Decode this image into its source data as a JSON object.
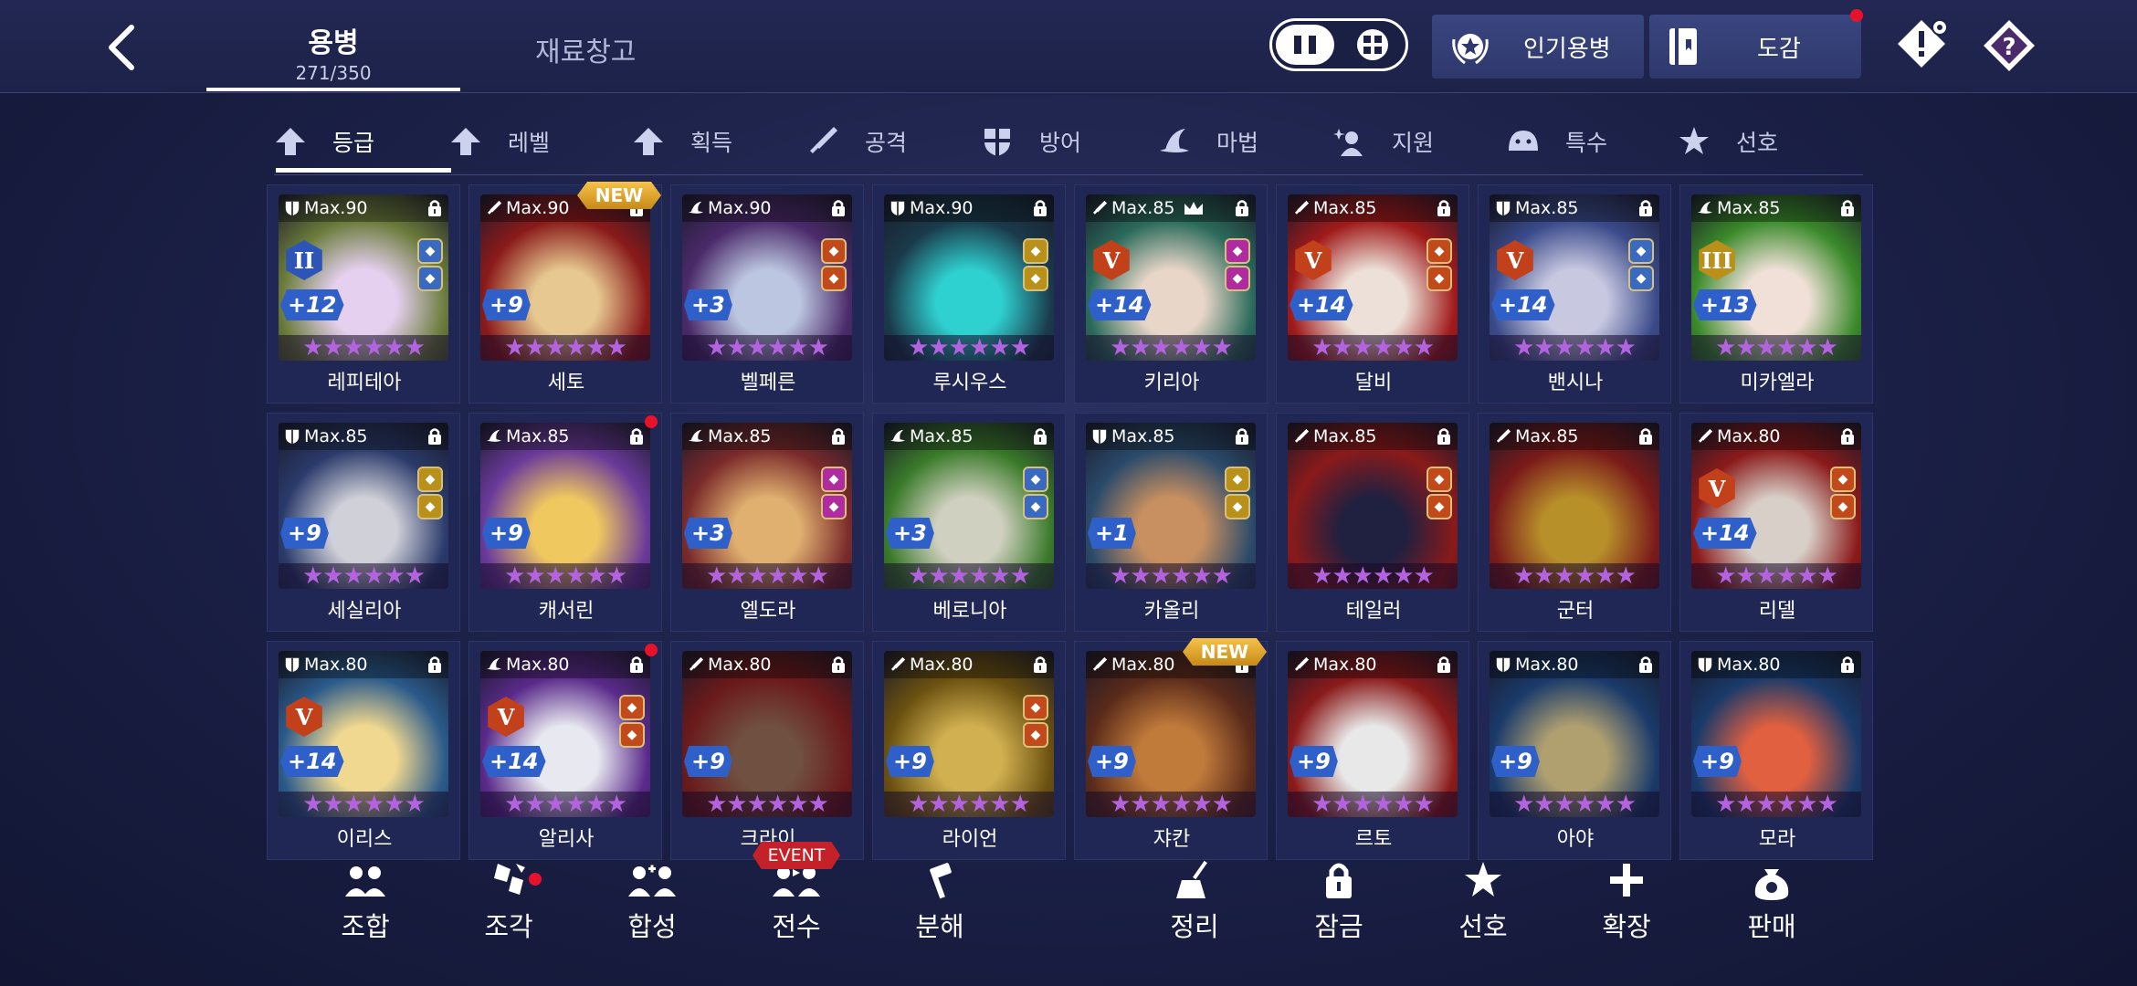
{
  "header": {
    "tab_main": {
      "label": "용병",
      "count": "271/350"
    },
    "tab_materials": "재료창고",
    "popular_label": "인기용병",
    "codex_label": "도감"
  },
  "filters": [
    {
      "label": "등급",
      "icon": "arrow-up-icon"
    },
    {
      "label": "레벨",
      "icon": "arrow-up-icon"
    },
    {
      "label": "획득",
      "icon": "arrow-up-icon"
    },
    {
      "label": "공격",
      "icon": "sword-icon"
    },
    {
      "label": "방어",
      "icon": "shield-icon"
    },
    {
      "label": "마법",
      "icon": "wizard-hat-icon"
    },
    {
      "label": "지원",
      "icon": "support-icon"
    },
    {
      "label": "특수",
      "icon": "blob-icon"
    },
    {
      "label": "선호",
      "icon": "star-icon"
    }
  ],
  "cards": [
    {
      "name": "레피테아",
      "max": "Max.90",
      "type": "shield",
      "plus": "+12",
      "rank": "II",
      "rankColor": "#2d55b8",
      "bg": [
        "#6a7b3a",
        "#e6d0f0"
      ],
      "gems": 2,
      "gemColor": "#3a6ac0",
      "new": false,
      "dot": false
    },
    {
      "name": "세토",
      "max": "Max.90",
      "type": "sword",
      "plus": "+9",
      "rank": "",
      "bg": [
        "#8a1a1a",
        "#e6c890"
      ],
      "gems": 0,
      "new": true,
      "newLabel": "NEW",
      "dot": false
    },
    {
      "name": "벨페른",
      "max": "Max.90",
      "type": "hat",
      "plus": "+3",
      "rank": "",
      "bg": [
        "#4a2a6a",
        "#bcc6e0"
      ],
      "gems": 2,
      "gemColor": "#c24a1a",
      "new": false,
      "dot": false
    },
    {
      "name": "루시우스",
      "max": "Max.90",
      "type": "shield",
      "plus": "",
      "rank": "",
      "bg": [
        "#1a3a4a",
        "#2fd0d0"
      ],
      "gems": 2,
      "gemColor": "#b8901a",
      "new": false,
      "dot": false
    },
    {
      "name": "키리아",
      "max": "Max.85",
      "type": "sword",
      "plus": "+14",
      "rank": "V",
      "rankColor": "#c2401a",
      "bg": [
        "#2a6a5a",
        "#e8d6c8"
      ],
      "gems": 2,
      "gemColor": "#b02aa0",
      "new": false,
      "dot": false,
      "crown": true
    },
    {
      "name": "달비",
      "max": "Max.85",
      "type": "sword",
      "plus": "+14",
      "rank": "V",
      "rankColor": "#c2401a",
      "bg": [
        "#a01a1a",
        "#ece0d8"
      ],
      "gems": 2,
      "gemColor": "#c24a1a",
      "new": false,
      "dot": false
    },
    {
      "name": "밴시나",
      "max": "Max.85",
      "type": "shield",
      "plus": "+14",
      "rank": "V",
      "rankColor": "#c2401a",
      "bg": [
        "#3a4a8a",
        "#c8c8e0"
      ],
      "gems": 2,
      "gemColor": "#3a6ac0",
      "new": false,
      "dot": false
    },
    {
      "name": "미카엘라",
      "max": "Max.85",
      "type": "hat",
      "plus": "+13",
      "rank": "III",
      "rankColor": "#b8901a",
      "bg": [
        "#3a8a2a",
        "#f0e0d8"
      ],
      "gems": 0,
      "new": false,
      "dot": false
    },
    {
      "name": "세실리아",
      "max": "Max.85",
      "type": "shield",
      "plus": "+9",
      "rank": "",
      "bg": [
        "#2a3a6a",
        "#d0d0d8"
      ],
      "gems": 2,
      "gemColor": "#b8901a",
      "new": false,
      "dot": false
    },
    {
      "name": "캐서린",
      "max": "Max.85",
      "type": "hat",
      "plus": "+9",
      "rank": "",
      "bg": [
        "#6a3a9a",
        "#f0c860"
      ],
      "gems": 0,
      "new": false,
      "dot": true
    },
    {
      "name": "엘도라",
      "max": "Max.85",
      "type": "hat",
      "plus": "+3",
      "rank": "",
      "bg": [
        "#7a2a2a",
        "#e0b070"
      ],
      "gems": 2,
      "gemColor": "#b02aa0",
      "new": false,
      "dot": false
    },
    {
      "name": "베로니아",
      "max": "Max.85",
      "type": "hat",
      "plus": "+3",
      "rank": "",
      "bg": [
        "#3a7a2a",
        "#d0d0c0"
      ],
      "gems": 2,
      "gemColor": "#3a6ac0",
      "new": false,
      "dot": false
    },
    {
      "name": "카올리",
      "max": "Max.85",
      "type": "shield",
      "plus": "+1",
      "rank": "",
      "bg": [
        "#2a4a6a",
        "#c89060"
      ],
      "gems": 2,
      "gemColor": "#b8901a",
      "new": false,
      "dot": false
    },
    {
      "name": "테일러",
      "max": "Max.85",
      "type": "sword",
      "plus": "",
      "rank": "",
      "bg": [
        "#8a1a1a",
        "#202040"
      ],
      "gems": 2,
      "gemColor": "#c24a1a",
      "new": false,
      "dot": false
    },
    {
      "name": "군터",
      "max": "Max.85",
      "type": "sword",
      "plus": "",
      "rank": "",
      "bg": [
        "#7a1a1a",
        "#b8902a"
      ],
      "gems": 0,
      "new": false,
      "dot": false
    },
    {
      "name": "리델",
      "max": "Max.80",
      "type": "sword",
      "plus": "+14",
      "rank": "V",
      "rankColor": "#c2401a",
      "bg": [
        "#8a1a1a",
        "#d8d0c8"
      ],
      "gems": 2,
      "gemColor": "#c24a1a",
      "new": false,
      "dot": false
    },
    {
      "name": "이리스",
      "max": "Max.80",
      "type": "shield",
      "plus": "+14",
      "rank": "V",
      "rankColor": "#c2401a",
      "bg": [
        "#2a5a8a",
        "#f0d890"
      ],
      "gems": 0,
      "new": false,
      "dot": false
    },
    {
      "name": "알리사",
      "max": "Max.80",
      "type": "hat",
      "plus": "+14",
      "rank": "V",
      "rankColor": "#c2401a",
      "bg": [
        "#5a2a8a",
        "#e8e8f0"
      ],
      "gems": 2,
      "gemColor": "#c24a1a",
      "new": false,
      "dot": true
    },
    {
      "name": "크라이",
      "max": "Max.80",
      "type": "sword",
      "plus": "+9",
      "rank": "",
      "bg": [
        "#6a1a1a",
        "#705040"
      ],
      "gems": 0,
      "new": false,
      "dot": false
    },
    {
      "name": "라이언",
      "max": "Max.80",
      "type": "sword",
      "plus": "+9",
      "rank": "",
      "bg": [
        "#6a5010",
        "#d0b050"
      ],
      "gems": 2,
      "gemColor": "#c24a1a",
      "new": false,
      "dot": false
    },
    {
      "name": "쟈칸",
      "max": "Max.80",
      "type": "sword",
      "plus": "+9",
      "rank": "",
      "bg": [
        "#5a2a1a",
        "#c07a3a"
      ],
      "gems": 0,
      "new": true,
      "newLabel": "NEW",
      "dot": false
    },
    {
      "name": "르토",
      "max": "Max.80",
      "type": "sword",
      "plus": "+9",
      "rank": "",
      "bg": [
        "#8a1a1a",
        "#e8e8e8"
      ],
      "gems": 0,
      "new": false,
      "dot": false
    },
    {
      "name": "아야",
      "max": "Max.80",
      "type": "shield",
      "plus": "+9",
      "rank": "",
      "bg": [
        "#1a3a6a",
        "#b0a070"
      ],
      "gems": 0,
      "new": false,
      "dot": false
    },
    {
      "name": "모라",
      "max": "Max.80",
      "type": "shield",
      "plus": "+9",
      "rank": "",
      "bg": [
        "#1a3a6a",
        "#e06040"
      ],
      "gems": 0,
      "new": false,
      "dot": false
    }
  ],
  "stars": "★★★★★★",
  "bottom": [
    {
      "label": "조합",
      "icon": "combine-icon"
    },
    {
      "label": "조각",
      "icon": "shard-icon",
      "dot": true
    },
    {
      "label": "합성",
      "icon": "merge-icon"
    },
    {
      "label": "전수",
      "icon": "inherit-icon",
      "tag": "EVENT"
    },
    {
      "label": "분해",
      "icon": "hammer-icon"
    },
    {
      "label": "정리",
      "icon": "broom-icon"
    },
    {
      "label": "잠금",
      "icon": "lock-icon"
    },
    {
      "label": "선호",
      "icon": "star-icon"
    },
    {
      "label": "확장",
      "icon": "plus-icon"
    },
    {
      "label": "판매",
      "icon": "moneybag-icon"
    }
  ],
  "colors": {
    "accent_red": "#e8132b",
    "star_purple": "#b463e0",
    "plus_blue": "#2f5fc8",
    "new_gold": "#f6c24a"
  }
}
